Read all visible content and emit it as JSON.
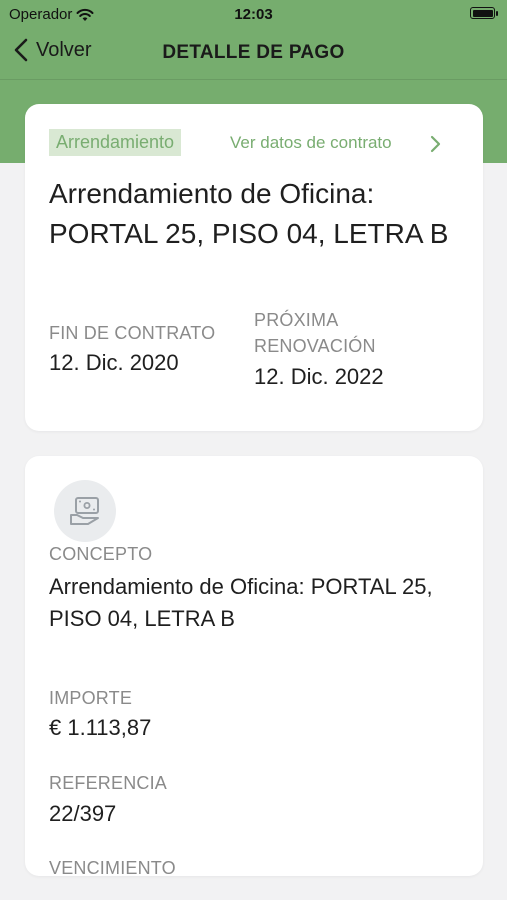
{
  "status_bar": {
    "carrier": "Operador",
    "time": "12:03",
    "battery_level": 1.0
  },
  "nav": {
    "back_label": "Volver",
    "title": "DETALLE DE PAGO"
  },
  "contract_card": {
    "tag": "Arrendamiento",
    "link_label": "Ver datos de contrato",
    "title": "Arrendamiento de Oficina: PORTAL 25, PISO 04, LETRA B",
    "end_label": "FIN DE CONTRATO",
    "end_value": "12. Dic. 2020",
    "renewal_label": "PRÓXIMA RENOVACIÓN",
    "renewal_value": "12. Dic. 2022"
  },
  "payment_card": {
    "icon": "payment-hand-icon",
    "concept_label": "CONCEPTO",
    "concept_value": "Arrendamiento de Oficina: PORTAL 25, PISO 04, LETRA B",
    "amount_label": "IMPORTE",
    "amount_value": "€ 1.113,87",
    "reference_label": "REFERENCIA",
    "reference_value": "22/397",
    "due_label": "VENCIMIENTO"
  },
  "colors": {
    "accent": "#76ad6e",
    "tag_bg": "#d9e8d3",
    "tag_text": "#79ad71",
    "background": "#f2f2f3"
  }
}
